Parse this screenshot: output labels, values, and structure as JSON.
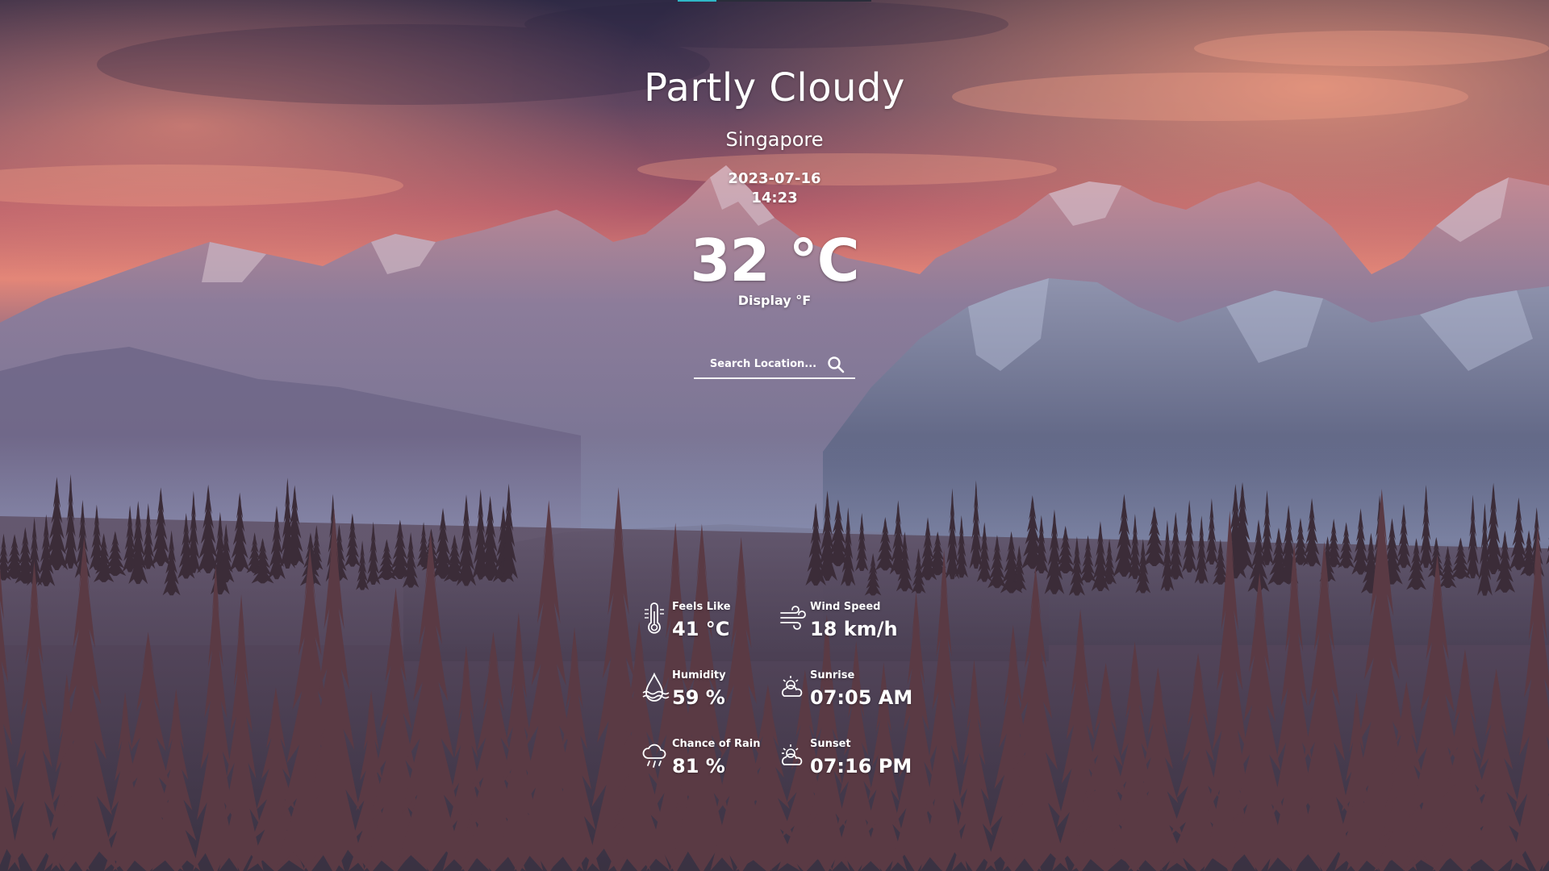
{
  "weather": {
    "condition": "Partly Cloudy",
    "location": "Singapore",
    "date": "2023-07-16",
    "time": "14:23",
    "temperature": "32 °C",
    "unit_toggle_label": "Display °F"
  },
  "search": {
    "placeholder": "Search Location...",
    "value": "",
    "icon": "search-icon"
  },
  "stats": {
    "feels_like": {
      "label": "Feels Like",
      "value": "41 °C",
      "icon": "thermometer-icon"
    },
    "humidity": {
      "label": "Humidity",
      "value": "59 %",
      "icon": "humidity-icon"
    },
    "chance_of_rain": {
      "label": "Chance of Rain",
      "value": "81 %",
      "icon": "rain-cloud-icon"
    },
    "wind_speed": {
      "label": "Wind Speed",
      "value": "18 km/h",
      "icon": "wind-icon"
    },
    "sunrise": {
      "label": "Sunrise",
      "value": "07:05 AM",
      "icon": "sunrise-icon"
    },
    "sunset": {
      "label": "Sunset",
      "value": "07:16 PM",
      "icon": "sunset-icon"
    }
  },
  "colors": {
    "text": "#ffffff",
    "accent": "#2fb8c7",
    "sky_top": "#3b3552",
    "sky_glow": "#e07a78",
    "mountain": "#5a5a78",
    "snow": "#c9cde0",
    "forest": "#3a2f3e"
  },
  "background": {
    "description_icon": "mountain-landscape-image"
  }
}
